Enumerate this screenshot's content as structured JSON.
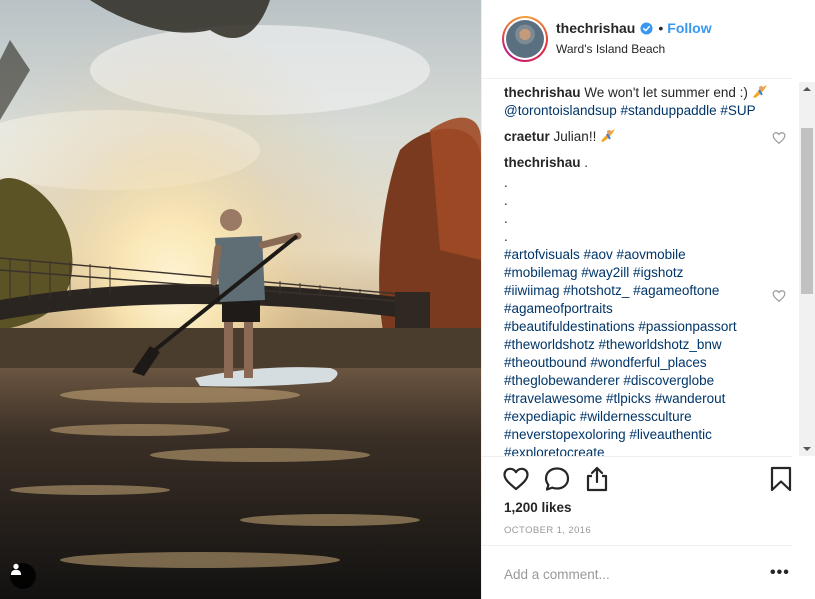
{
  "post": {
    "username": "thechrishau",
    "follow_label": "Follow",
    "separator": "•",
    "location": "Ward's Island Beach",
    "icons": {
      "verified": "verified-badge-icon",
      "like": "heart-icon",
      "comment": "speech-bubble-icon",
      "share": "share-icon",
      "save": "bookmark-icon",
      "user_tag": "person-icon"
    }
  },
  "caption": {
    "username": "thechrishau",
    "text": "We won't let summer end :)",
    "emoji_name": "surfer-emoji",
    "tags": "@torontoislandsup #standuppaddle #SUP"
  },
  "comments": [
    {
      "username": "craetur",
      "text": "Julian!!",
      "emoji_name": "surfer-emoji"
    },
    {
      "username": "thechrishau",
      "text": ".",
      "lines": [
        ".",
        ".",
        ".",
        ".",
        "#artofvisuals #aov #aovmobile",
        "#mobilemag #way2ill #igshotz",
        "#iiwiimag #hotshotz_ #agameoftone",
        "#agameofportraits",
        "#beautifuldestinations #passionpassort",
        "#theworldshotz #theworldshotz_bnw",
        "#theoutbound #wondferful_places",
        "#theglobewanderer #discoverglobe",
        "#travelawesome #tlpicks #wanderout",
        "#expediapic #wildernessculture",
        "#neverstopexoloring #liveauthentic",
        "#exploretocreate"
      ]
    }
  ],
  "likes_label": "1,200 likes",
  "date_label": "OCTOBER 1, 2016",
  "comment_input": {
    "placeholder": "Add a comment..."
  },
  "more_options_label": "•••",
  "colors": {
    "link_blue": "#3897f0",
    "hashtag_blue": "#003569",
    "text": "#262626",
    "muted": "#999999",
    "border": "#efefef"
  }
}
